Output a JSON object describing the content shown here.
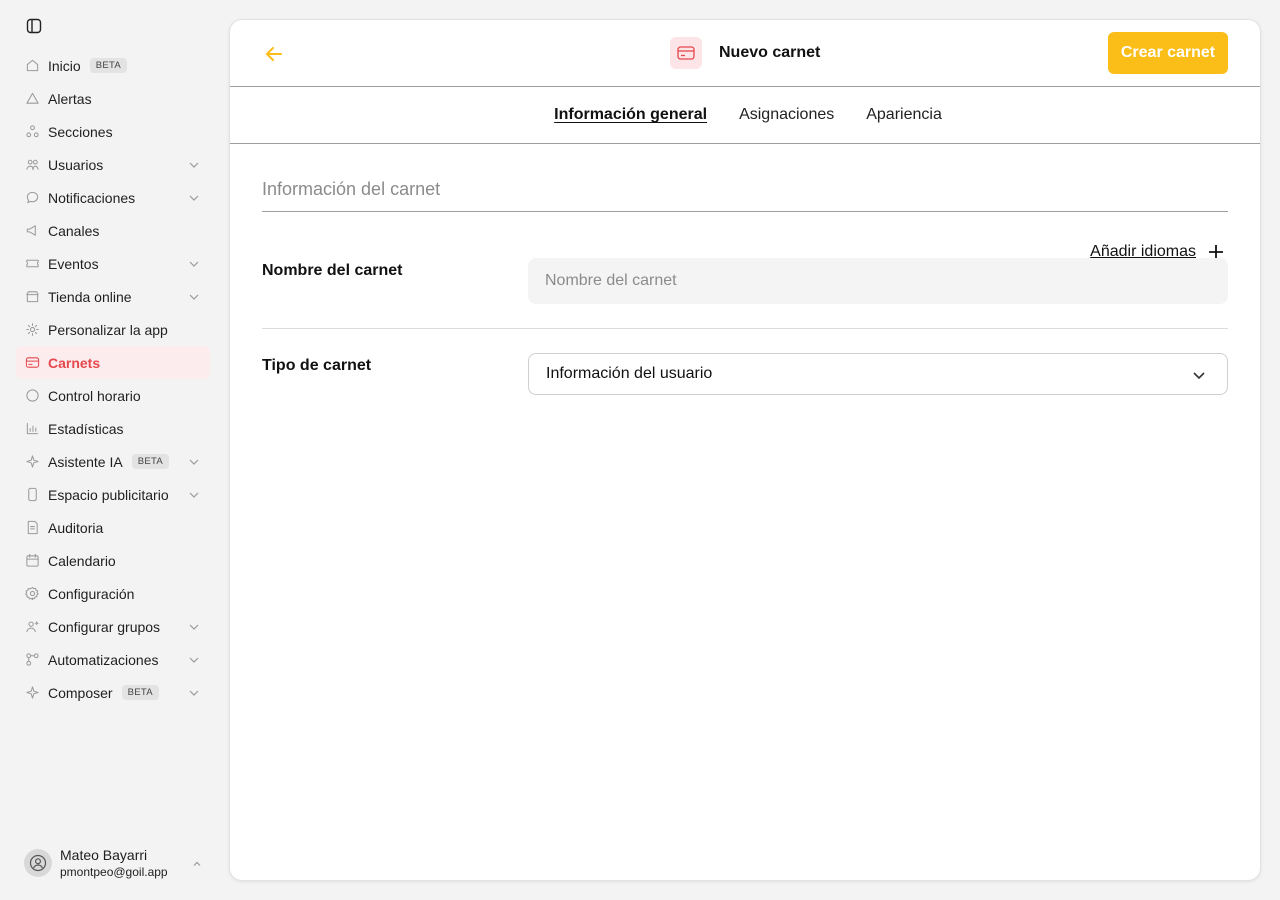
{
  "sidebar": {
    "items": [
      {
        "label": "Inicio",
        "icon": "home-icon",
        "badge": "BETA",
        "chevron": false,
        "active": false
      },
      {
        "label": "Alertas",
        "icon": "alert-icon",
        "badge": "",
        "chevron": false,
        "active": false
      },
      {
        "label": "Secciones",
        "icon": "sections-icon",
        "badge": "",
        "chevron": false,
        "active": false
      },
      {
        "label": "Usuarios",
        "icon": "users-icon",
        "badge": "",
        "chevron": true,
        "active": false
      },
      {
        "label": "Notificaciones",
        "icon": "message-icon",
        "badge": "",
        "chevron": true,
        "active": false
      },
      {
        "label": "Canales",
        "icon": "megaphone-icon",
        "badge": "",
        "chevron": false,
        "active": false
      },
      {
        "label": "Eventos",
        "icon": "ticket-icon",
        "badge": "",
        "chevron": true,
        "active": false
      },
      {
        "label": "Tienda online",
        "icon": "store-icon",
        "badge": "",
        "chevron": true,
        "active": false
      },
      {
        "label": "Personalizar la app",
        "icon": "customize-icon",
        "badge": "",
        "chevron": false,
        "active": false
      },
      {
        "label": "Carnets",
        "icon": "card-icon",
        "badge": "",
        "chevron": false,
        "active": true
      },
      {
        "label": "Control horario",
        "icon": "clock-icon",
        "badge": "",
        "chevron": false,
        "active": false
      },
      {
        "label": "Estadísticas",
        "icon": "chart-icon",
        "badge": "",
        "chevron": false,
        "active": false
      },
      {
        "label": "Asistente IA",
        "icon": "sparkle-icon",
        "badge": "BETA",
        "chevron": true,
        "active": false
      },
      {
        "label": "Espacio publicitario",
        "icon": "phone-icon",
        "badge": "",
        "chevron": true,
        "active": false
      },
      {
        "label": "Auditoria",
        "icon": "audit-icon",
        "badge": "",
        "chevron": false,
        "active": false
      },
      {
        "label": "Calendario",
        "icon": "calendar-icon",
        "badge": "",
        "chevron": false,
        "active": false
      },
      {
        "label": "Configuración",
        "icon": "gear-icon",
        "badge": "",
        "chevron": false,
        "active": false
      },
      {
        "label": "Configurar grupos",
        "icon": "group-icon",
        "badge": "",
        "chevron": true,
        "active": false
      },
      {
        "label": "Automatizaciones",
        "icon": "automation-icon",
        "badge": "",
        "chevron": true,
        "active": false
      },
      {
        "label": "Composer",
        "icon": "sparkle-icon",
        "badge": "BETA",
        "chevron": true,
        "active": false
      }
    ],
    "user": {
      "name": "Mateo Bayarri",
      "email": "pmontpeo@goil.app"
    }
  },
  "header": {
    "title": "Nuevo carnet",
    "primary_button": "Crear carnet"
  },
  "tabs": [
    {
      "label": "Información general",
      "active": true
    },
    {
      "label": "Asignaciones",
      "active": false
    },
    {
      "label": "Apariencia",
      "active": false
    }
  ],
  "form": {
    "section_title": "Información del carnet",
    "add_languages": "Añadir idiomas",
    "name_label": "Nombre del carnet",
    "name_value": "",
    "name_placeholder": "Nombre del carnet",
    "type_label": "Tipo de carnet",
    "type_value": "Información del usuario"
  },
  "colors": {
    "accent": "#fbbd17",
    "active_nav": "#e5484d",
    "active_nav_bg": "#fdeced"
  }
}
